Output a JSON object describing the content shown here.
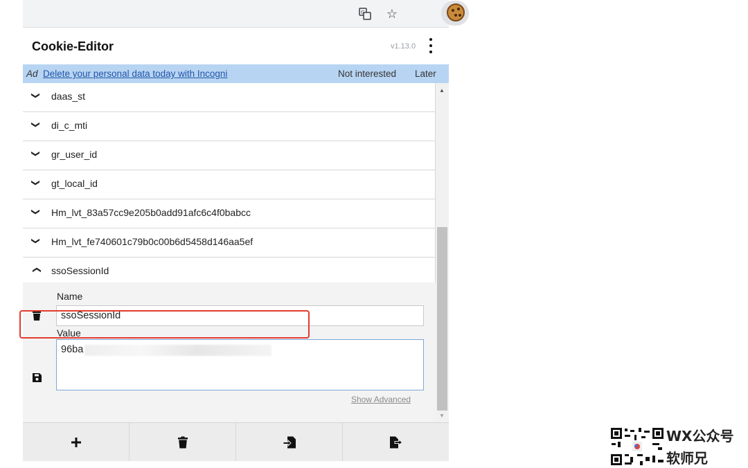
{
  "browser": {
    "toolbar_icons": [
      "translate-icon",
      "bookmark-star-icon",
      "cookie-extension-icon"
    ]
  },
  "header": {
    "title": "Cookie-Editor",
    "version": "v1.13.0"
  },
  "ad": {
    "label": "Ad",
    "link": "Delete your personal data today with Incogni",
    "not_interested": "Not interested",
    "later": "Later"
  },
  "cookies": [
    {
      "name": "daas_st",
      "expanded": false
    },
    {
      "name": "di_c_mti",
      "expanded": false
    },
    {
      "name": "gr_user_id",
      "expanded": false
    },
    {
      "name": "gt_local_id",
      "expanded": false
    },
    {
      "name": "Hm_lvt_83a57cc9e205b0add91afc6c4f0babcc",
      "expanded": false
    },
    {
      "name": "Hm_lvt_fe740601c79b0c00b6d5458d146aa5ef",
      "expanded": false
    },
    {
      "name": "ssoSessionId",
      "expanded": true
    }
  ],
  "detail": {
    "name_label": "Name",
    "name_value": "ssoSessionId",
    "value_label": "Value",
    "value_value": "96ba",
    "show_advanced": "Show Advanced"
  },
  "actions": {
    "icons": [
      "add-icon",
      "delete-all-icon",
      "import-icon",
      "export-icon"
    ]
  },
  "watermark": {
    "line1": "WX公众号",
    "line2": "软师兄"
  },
  "colors": {
    "ad_bar": "#b7d4f2",
    "highlight": "#e23b2e",
    "link": "#2255aa"
  }
}
